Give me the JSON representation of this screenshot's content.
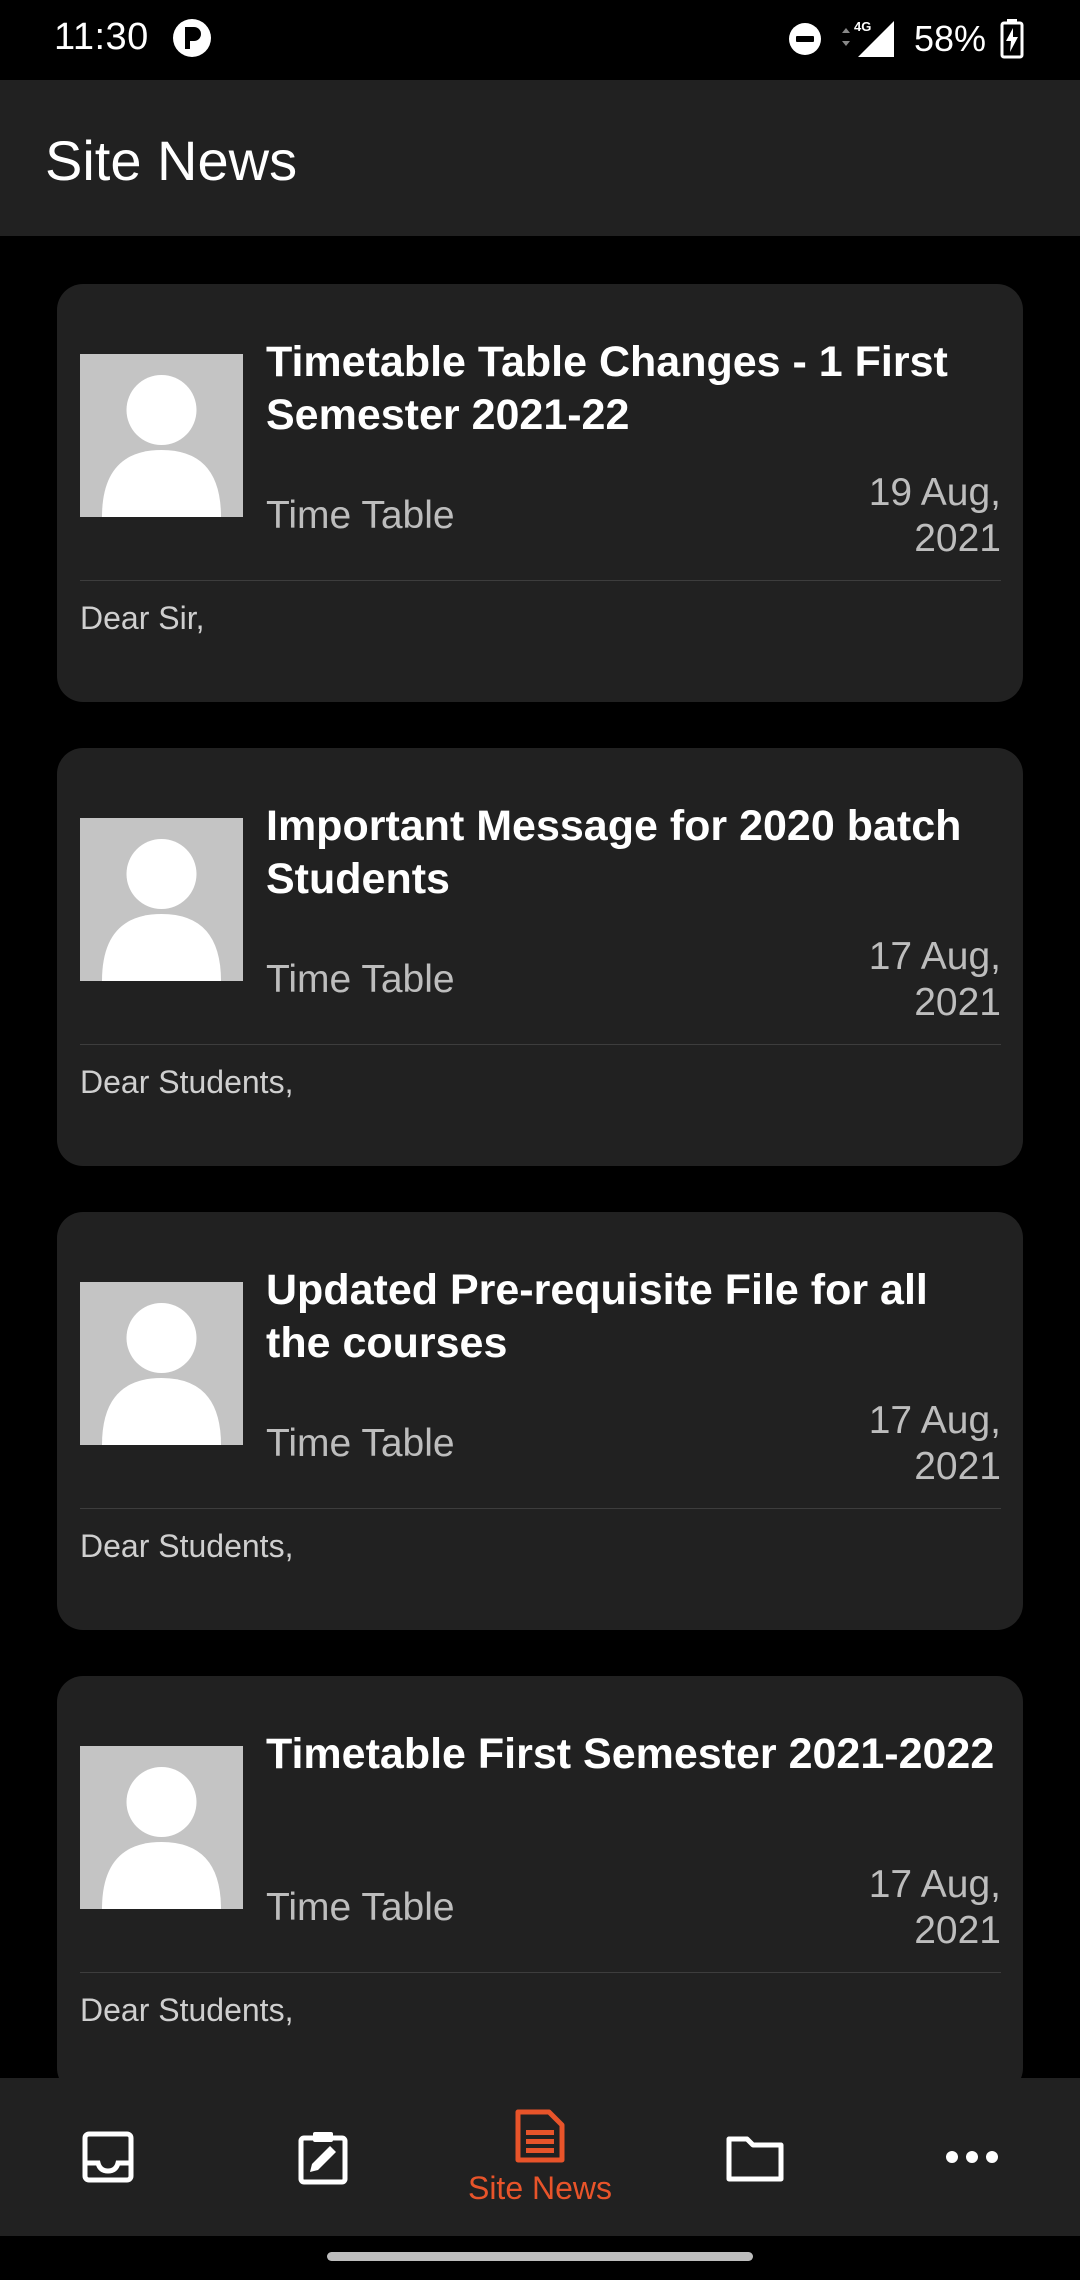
{
  "status_bar": {
    "time": "11:30",
    "network": "4G",
    "battery": "58%"
  },
  "app_bar": {
    "title": "Site News"
  },
  "news": [
    {
      "title": "Timetable Table Changes - 1 First Semester 2021-22",
      "category": "Time Table",
      "date": "19 Aug, 2021",
      "snippet": "Dear Sir,"
    },
    {
      "title": "Important Message for 2020 batch Students",
      "category": "Time Table",
      "date": "17 Aug, 2021",
      "snippet": "Dear Students,"
    },
    {
      "title": "Updated Pre-requisite File for all the courses",
      "category": "Time Table",
      "date": "17 Aug, 2021",
      "snippet": "Dear Students,"
    },
    {
      "title": "Timetable First Semester 2021-2022",
      "category": "Time Table",
      "date": "17 Aug, 2021",
      "snippet": "Dear Students,"
    }
  ],
  "bottom_nav": {
    "items": [
      {
        "icon": "inbox-icon",
        "label": ""
      },
      {
        "icon": "assignment-icon",
        "label": ""
      },
      {
        "icon": "news-icon",
        "label": "Site News",
        "active": true
      },
      {
        "icon": "folder-icon",
        "label": ""
      },
      {
        "icon": "more-icon",
        "label": ""
      }
    ]
  },
  "colors": {
    "background": "#000000",
    "surface": "#212121",
    "accent": "#e8542a",
    "text_primary": "#ffffff",
    "text_secondary": "#bdbdbd",
    "avatar_bg": "#c4c4c4"
  }
}
